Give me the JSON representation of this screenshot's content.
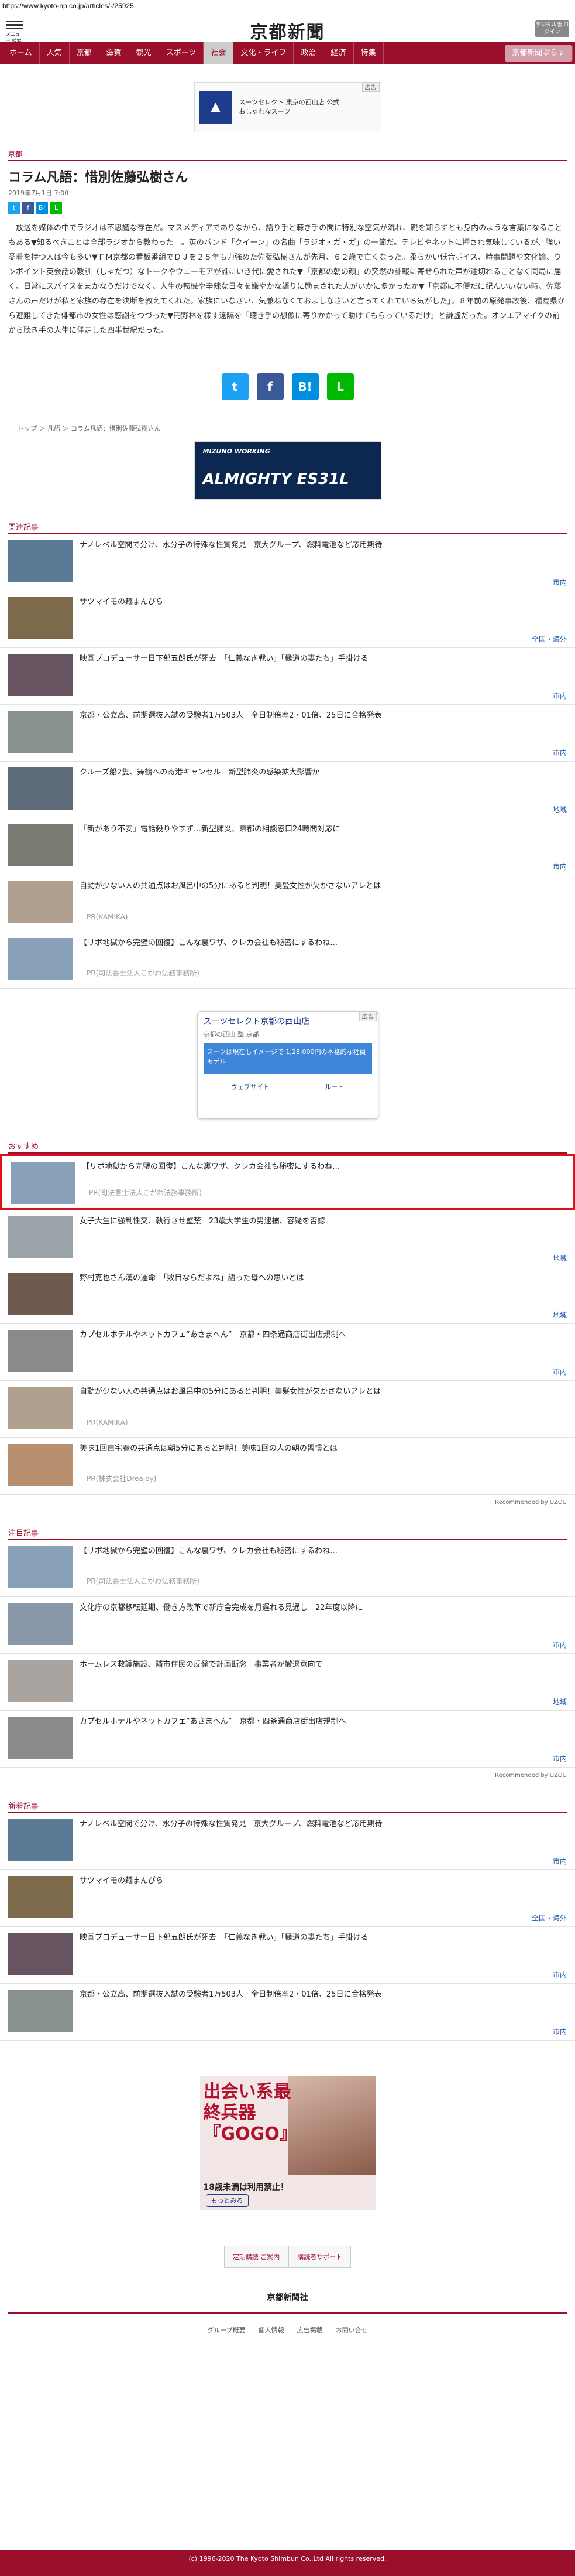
{
  "url": "https://www.kyoto-np.co.jp/articles/-/25925",
  "header": {
    "logo": "京都新聞",
    "menu_label": "メニュー 検索",
    "digital_label": "デジタル版 ログイン"
  },
  "nav": [
    "ホーム",
    "人気",
    "京都",
    "滋賀",
    "観光",
    "スポーツ",
    "社会",
    "文化・ライフ",
    "政治",
    "経済",
    "特集",
    "京都新聞ぷらす"
  ],
  "ad1": {
    "tag": "広告",
    "title": "スーツセレクト 東京の西山店 公式",
    "sub": "おしゃれなスーツ"
  },
  "section": "京都",
  "article": {
    "title": "コラム凡語：惜別佐藤弘樹さん",
    "date": "2019年7月1日 7:00",
    "body": "放送を媒体の中でラジオは不思議な存在だ。マスメディアでありながら、語り手と聴き手の間に特別な空気が流れ、親を知らずとも身内のような言葉になることもある▼知るべきことは全部ラジオから教わった—。英のバンド「クイーン」の名曲「ラジオ・ガ・ガ」の一節だ。テレビやネットに押され気味しているが、強い愛着を持つ人は今も多い▼ＦＭ京都の看板番組でＤＪを２５年も力強めた佐藤弘樹さんが先月、６２歳で亡くなった。柔らかい低音ボイス、時事問題や文化論、ウンボイント英会話の教訓（しゃだつ）なトークやウエーモアが誰にいき代に愛された▼「京都の朝の顔」の突然の訃報に寄せられた声が途切れることなく同局に届く。日常にスパイスをまかなうだけでなく、人生の転機や辛辣な日々を嫌やかな語りに励まされた人がいかに多かったか▼「京都に不便だに紀んいいない時、佐藤さんの声だけが私と家族の存在を決断を教えてくれた。家族にいなさい、気兼ねなくておよしなさいと言ってくれている気がした」。８年前の原発事故後、福島県から避難してきた俳都市の女性は感謝をつづった▼円野林を様す遠隔を「聴き手の想像に寄りかかって助けてもらっているだけ」と謙虚だった。オンエアマイクの前から聴き手の人生に伴走した四半世紀だった。",
    "share": [
      "t",
      "f",
      "B!",
      "L"
    ]
  },
  "breadcrumb": "トップ ＞ 凡語 ＞ コラム凡語：惜別佐藤弘樹さん",
  "ad2": {
    "brand": "MIZUNO WORKING",
    "model": "ALMIGHTY ES31L"
  },
  "related_title": "関連記事",
  "related": [
    {
      "title": "ナノレベル空間で分け、水分子の特殊な性質発見　京大グループ、燃料電池など応用期待",
      "tag": "市内",
      "color": "#5a7a96"
    },
    {
      "title": "サツマイモの麺まんびら",
      "tag": "全国・海外",
      "color": "#7d6a4a"
    },
    {
      "title": "映画プロデューサー日下部五朗氏が死去　「仁義なき戦い」「極道の妻たち」手掛ける",
      "tag": "市内",
      "color": "#665560"
    },
    {
      "title": "京都・公立高、前期選抜入試の受験者1万503人　全日制倍率2・01倍、25日に合格発表",
      "tag": "市内",
      "color": "#889090"
    },
    {
      "title": "クルーズ船2隻、舞鶴への寄港キャンセル　新型肺炎の感染拡大影響か",
      "tag": "地域",
      "color": "#5d6a78"
    },
    {
      "title": "「新があり不安」電話殺りやすず…新型肺炎、京都の相談窓口24時間対応に",
      "tag": "市内",
      "color": "#7a7a72"
    },
    {
      "title": "自動が少ない人の共通点はお風呂中の5分にあると判明！美髪女性が欠かさないアレとは",
      "pr": "PR(KAMIKA)",
      "color": "#b0a090"
    },
    {
      "title": "【リボ地獄から完璧の回復】こんな裏ワザ、クレカ会社も秘密にするわね…",
      "pr": "PR(司法書士法人こがわ法務事務所)",
      "color": "#88a0b8"
    }
  ],
  "map_ad": {
    "tag": "広告",
    "title": "スーツセレクト京都の西山店",
    "sub": "京都の西山 整 京都",
    "blue": "スーツは現在もイメージで 1,28,000円の本格的な社員モデル",
    "route": "ウェブサイト",
    "dir": "ルート"
  },
  "osusume_title": "おすすめ",
  "osusume": [
    {
      "title": "【リボ地獄から完璧の回復】こんな裏ワザ、クレカ会社も秘密にするわね…",
      "pr": "PR(司法書士法人こがわ法務事務所)",
      "color": "#88a0b8"
    },
    {
      "title": "女子大生に強制性交、執行させ監禁　23歳大学生の男逮捕、容疑を否認",
      "tag": "地域",
      "color": "#9aa4a8"
    },
    {
      "title": "野村克也さん漢の運命　「敗目ならだよね」語った母への思いとは",
      "tag": "地域",
      "color": "#705a50"
    },
    {
      "title": "カプセルホテルやネットカフェ“あさまへん”　京都・四条通商店街出店規制へ",
      "tag": "市内",
      "color": "#8a8a88"
    },
    {
      "title": "自動が少ない人の共通点はお風呂中の5分にあると判明！美髪女性が欠かさないアレとは",
      "pr": "PR(KAMIKA)",
      "color": "#b0a090"
    },
    {
      "title": "美味1回自宅春の共通点は朝5分にあると判明！美味1回の人の朝の習慣とは",
      "pr": "PR(株式会社Dreajoy)",
      "color": "#b89070"
    }
  ],
  "recommended_by": "Recommended by UZOU",
  "chui_title": "注目記事",
  "chui": [
    {
      "title": "【リボ地獄から完璧の回復】こんな裏ワザ、クレカ会社も秘密にするわね…",
      "pr": "PR(司法書士法人こがわ法務事務所)",
      "color": "#88a0b8"
    },
    {
      "title": "文化庁の京都移転延期、働き方改革で新庁舎完成を月遅れる見通し　22年度以降に",
      "tag": "市内",
      "color": "#8898a8"
    },
    {
      "title": "ホームレス救護施設、隣市住民の反発で計画断念　事業者が撤退意向で",
      "tag": "地域",
      "color": "#aaa4a0"
    },
    {
      "title": "カプセルホテルやネットカフェ“あさまへん”　京都・四条通商店街出店規制へ",
      "tag": "市内",
      "color": "#8a8a88"
    }
  ],
  "shinchaku_title": "新着記事",
  "shinchaku": [
    {
      "title": "ナノレベル空間で分け、水分子の特殊な性質発見　京大グループ、燃料電池など応用期待",
      "tag": "市内",
      "color": "#5a7a96"
    },
    {
      "title": "サツマイモの麺まんびら",
      "tag": "全国・海外",
      "color": "#7d6a4a"
    },
    {
      "title": "映画プロデューサー日下部五朗氏が死去　「仁義なき戦い」「極道の妻たち」手掛ける",
      "tag": "市内",
      "color": "#665560"
    },
    {
      "title": "京都・公立高、前期選抜入試の受験者1万503人　全日制倍率2・01倍、25日に合格発表",
      "tag": "市内",
      "color": "#889090"
    }
  ],
  "bottom_ad": {
    "headline": "出会い系最終兵器『GOGO』",
    "foot": "18歳未満は利用禁止！",
    "btn": "もっとみる"
  },
  "bottom_links": [
    "定期購読 ご案内",
    "購読者サポート"
  ],
  "footer": {
    "logo": "京都新聞社",
    "nav": [
      "グループ概要",
      "個人情報",
      "広告掲載",
      "お問い合せ"
    ],
    "copy": "(c) 1996-2020 The Kyoto Shimbun Co.,Ltd All rights reserved."
  }
}
